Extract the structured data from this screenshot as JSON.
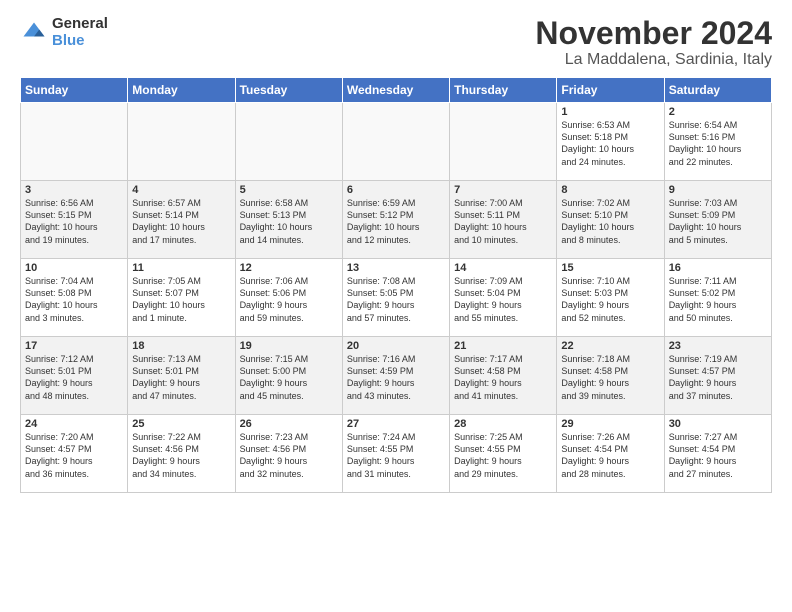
{
  "logo": {
    "general": "General",
    "blue": "Blue"
  },
  "title": "November 2024",
  "location": "La Maddalena, Sardinia, Italy",
  "days_of_week": [
    "Sunday",
    "Monday",
    "Tuesday",
    "Wednesday",
    "Thursday",
    "Friday",
    "Saturday"
  ],
  "weeks": [
    [
      {
        "day": "",
        "info": ""
      },
      {
        "day": "",
        "info": ""
      },
      {
        "day": "",
        "info": ""
      },
      {
        "day": "",
        "info": ""
      },
      {
        "day": "",
        "info": ""
      },
      {
        "day": "1",
        "info": "Sunrise: 6:53 AM\nSunset: 5:18 PM\nDaylight: 10 hours\nand 24 minutes."
      },
      {
        "day": "2",
        "info": "Sunrise: 6:54 AM\nSunset: 5:16 PM\nDaylight: 10 hours\nand 22 minutes."
      }
    ],
    [
      {
        "day": "3",
        "info": "Sunrise: 6:56 AM\nSunset: 5:15 PM\nDaylight: 10 hours\nand 19 minutes."
      },
      {
        "day": "4",
        "info": "Sunrise: 6:57 AM\nSunset: 5:14 PM\nDaylight: 10 hours\nand 17 minutes."
      },
      {
        "day": "5",
        "info": "Sunrise: 6:58 AM\nSunset: 5:13 PM\nDaylight: 10 hours\nand 14 minutes."
      },
      {
        "day": "6",
        "info": "Sunrise: 6:59 AM\nSunset: 5:12 PM\nDaylight: 10 hours\nand 12 minutes."
      },
      {
        "day": "7",
        "info": "Sunrise: 7:00 AM\nSunset: 5:11 PM\nDaylight: 10 hours\nand 10 minutes."
      },
      {
        "day": "8",
        "info": "Sunrise: 7:02 AM\nSunset: 5:10 PM\nDaylight: 10 hours\nand 8 minutes."
      },
      {
        "day": "9",
        "info": "Sunrise: 7:03 AM\nSunset: 5:09 PM\nDaylight: 10 hours\nand 5 minutes."
      }
    ],
    [
      {
        "day": "10",
        "info": "Sunrise: 7:04 AM\nSunset: 5:08 PM\nDaylight: 10 hours\nand 3 minutes."
      },
      {
        "day": "11",
        "info": "Sunrise: 7:05 AM\nSunset: 5:07 PM\nDaylight: 10 hours\nand 1 minute."
      },
      {
        "day": "12",
        "info": "Sunrise: 7:06 AM\nSunset: 5:06 PM\nDaylight: 9 hours\nand 59 minutes."
      },
      {
        "day": "13",
        "info": "Sunrise: 7:08 AM\nSunset: 5:05 PM\nDaylight: 9 hours\nand 57 minutes."
      },
      {
        "day": "14",
        "info": "Sunrise: 7:09 AM\nSunset: 5:04 PM\nDaylight: 9 hours\nand 55 minutes."
      },
      {
        "day": "15",
        "info": "Sunrise: 7:10 AM\nSunset: 5:03 PM\nDaylight: 9 hours\nand 52 minutes."
      },
      {
        "day": "16",
        "info": "Sunrise: 7:11 AM\nSunset: 5:02 PM\nDaylight: 9 hours\nand 50 minutes."
      }
    ],
    [
      {
        "day": "17",
        "info": "Sunrise: 7:12 AM\nSunset: 5:01 PM\nDaylight: 9 hours\nand 48 minutes."
      },
      {
        "day": "18",
        "info": "Sunrise: 7:13 AM\nSunset: 5:01 PM\nDaylight: 9 hours\nand 47 minutes."
      },
      {
        "day": "19",
        "info": "Sunrise: 7:15 AM\nSunset: 5:00 PM\nDaylight: 9 hours\nand 45 minutes."
      },
      {
        "day": "20",
        "info": "Sunrise: 7:16 AM\nSunset: 4:59 PM\nDaylight: 9 hours\nand 43 minutes."
      },
      {
        "day": "21",
        "info": "Sunrise: 7:17 AM\nSunset: 4:58 PM\nDaylight: 9 hours\nand 41 minutes."
      },
      {
        "day": "22",
        "info": "Sunrise: 7:18 AM\nSunset: 4:58 PM\nDaylight: 9 hours\nand 39 minutes."
      },
      {
        "day": "23",
        "info": "Sunrise: 7:19 AM\nSunset: 4:57 PM\nDaylight: 9 hours\nand 37 minutes."
      }
    ],
    [
      {
        "day": "24",
        "info": "Sunrise: 7:20 AM\nSunset: 4:57 PM\nDaylight: 9 hours\nand 36 minutes."
      },
      {
        "day": "25",
        "info": "Sunrise: 7:22 AM\nSunset: 4:56 PM\nDaylight: 9 hours\nand 34 minutes."
      },
      {
        "day": "26",
        "info": "Sunrise: 7:23 AM\nSunset: 4:56 PM\nDaylight: 9 hours\nand 32 minutes."
      },
      {
        "day": "27",
        "info": "Sunrise: 7:24 AM\nSunset: 4:55 PM\nDaylight: 9 hours\nand 31 minutes."
      },
      {
        "day": "28",
        "info": "Sunrise: 7:25 AM\nSunset: 4:55 PM\nDaylight: 9 hours\nand 29 minutes."
      },
      {
        "day": "29",
        "info": "Sunrise: 7:26 AM\nSunset: 4:54 PM\nDaylight: 9 hours\nand 28 minutes."
      },
      {
        "day": "30",
        "info": "Sunrise: 7:27 AM\nSunset: 4:54 PM\nDaylight: 9 hours\nand 27 minutes."
      }
    ]
  ]
}
